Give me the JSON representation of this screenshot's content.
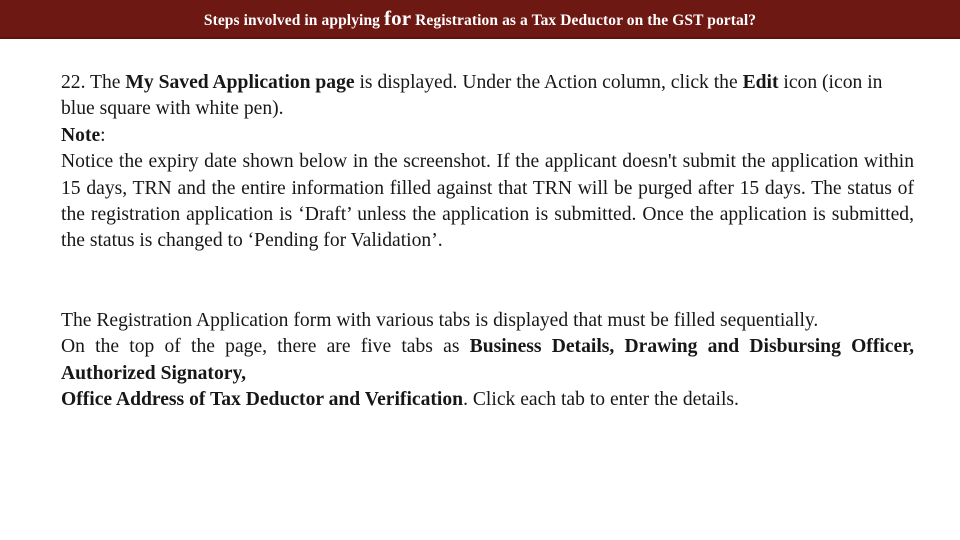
{
  "header": {
    "title_part1": "Steps involved in applying ",
    "title_emphasis": "for",
    "title_part2": " Registration as a Tax Deductor on the GST portal?",
    "background_color": "#6E1813",
    "text_color": "#FFFFFF"
  },
  "body": {
    "background_color": "#FFFFFF",
    "text_color": "#171717",
    "step_22": {
      "number_and_lead": "22. The ",
      "bold_1": "My Saved Application page",
      "after_bold_1": " is displayed. Under the Action column, click the ",
      "bold_2": "Edit",
      "after_bold_2": " icon (icon in blue square with white pen)."
    },
    "note": {
      "label": "Note",
      "colon": ":",
      "text": "Notice the expiry date shown below in the screenshot. If the applicant doesn't submit the application within 15 days, TRN and the entire information filled against that TRN will be purged after 15 days. The status of the registration application is ‘Draft’ unless the application is submitted. Once the application is submitted, the status is changed to ‘Pending for Validation’."
    },
    "registration_form": {
      "line_1": "The Registration Application form with various tabs is displayed that must be filled sequentially.",
      "line_2_prefix": "On the top of the page, there are five tabs as ",
      "tabs_bold_part1": "Business Details, Drawing and Disbursing Officer, Authorized Signatory,",
      "tabs_bold_part2": "Office Address of Tax Deductor and Verification",
      "line_2_suffix": ". Click each tab to enter the details."
    }
  }
}
